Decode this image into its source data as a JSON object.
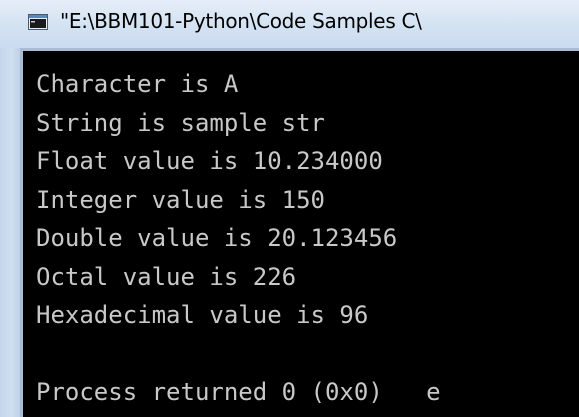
{
  "window": {
    "title": "\"E:\\BBM101-Python\\Code Samples C\\"
  },
  "console": {
    "lines": [
      "Character is A",
      "String is sample str",
      "Float value is 10.234000",
      "Integer value is 150",
      "Double value is 20.123456",
      "Octal value is 226",
      "Hexadecimal value is 96",
      "",
      "Process returned 0 (0x0)   e"
    ],
    "text_color": "#c8c8c8",
    "background_color": "#000000"
  },
  "icons": {
    "app": "console-window-icon"
  }
}
